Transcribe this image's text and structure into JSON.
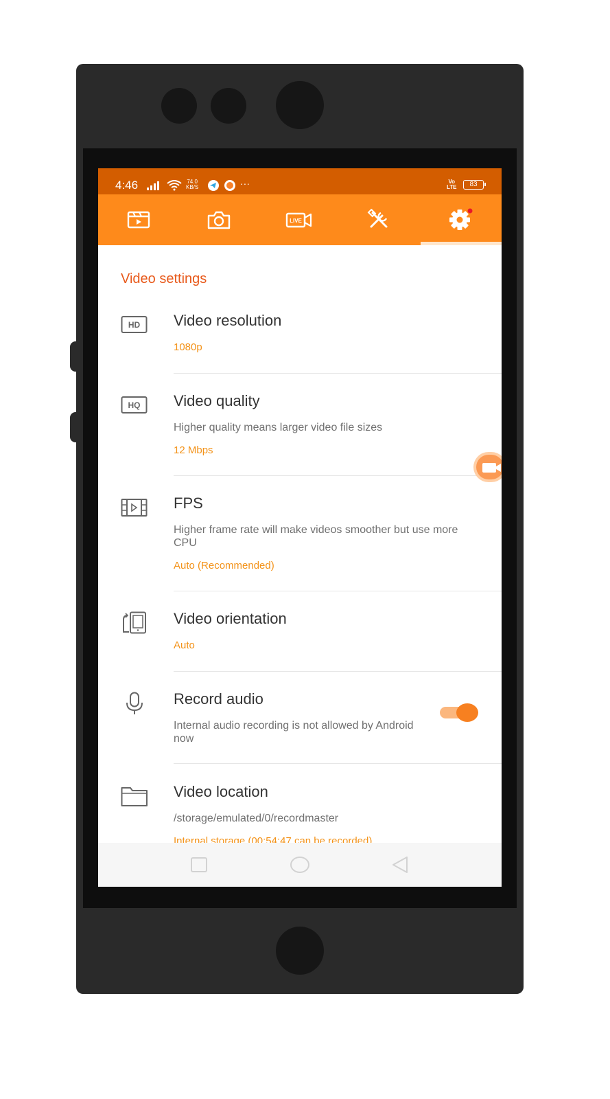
{
  "status_bar": {
    "time": "4:46",
    "speed_top": "74.0",
    "speed_unit": "KB/S",
    "dots": "···",
    "volte_top": "Vo",
    "volte_bottom": "LTE",
    "battery": "83"
  },
  "tabs": [
    {
      "icon": "video-list-icon"
    },
    {
      "icon": "camera-icon"
    },
    {
      "icon": "live-video-icon",
      "label": "LIVE"
    },
    {
      "icon": "tools-icon"
    },
    {
      "icon": "gear-icon",
      "selected": true,
      "badge": true
    }
  ],
  "section_title": "Video settings",
  "settings": {
    "resolution": {
      "icon_text": "HD",
      "title": "Video resolution",
      "value": "1080p"
    },
    "quality": {
      "icon_text": "HQ",
      "title": "Video quality",
      "desc": "Higher quality means larger video file sizes",
      "value": "12 Mbps"
    },
    "fps": {
      "title": "FPS",
      "desc": "Higher frame rate will make videos smoother but use more CPU",
      "value": "Auto (Recommended)"
    },
    "orientation": {
      "title": "Video orientation",
      "value": "Auto"
    },
    "audio": {
      "title": "Record audio",
      "desc": "Internal audio recording is not allowed by Android now",
      "toggle_on": true
    },
    "location": {
      "title": "Video location",
      "path": "/storage/emulated/0/recordmaster",
      "value": "Internal storage (00:54:47 can be recorded)"
    }
  },
  "colors": {
    "accent": "#fe8a1b",
    "status_bar": "#d35d00",
    "section_title": "#e8591a",
    "value_text": "#f39218"
  }
}
